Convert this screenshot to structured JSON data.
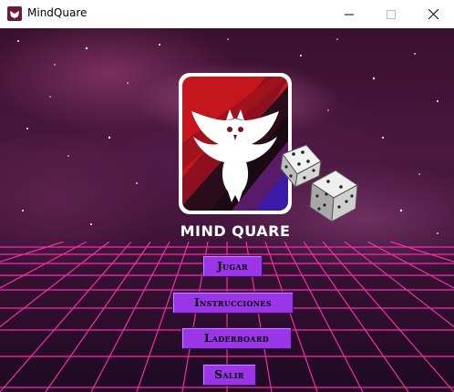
{
  "window": {
    "title": "MindQuare",
    "controls": [
      "minimize-icon",
      "maximize-icon",
      "close-icon"
    ]
  },
  "main": {
    "game_title": "MIND QUARE",
    "logo_icon": "owl-icon",
    "dice_icon": "dice-icon",
    "buttons": {
      "play": "Jugar",
      "instructions": "Instrucciones",
      "leaderboard": "Laderboard",
      "exit": "Salir"
    }
  },
  "colors": {
    "button_bg": "#9a35e8",
    "grid_line": "#ff2fb0",
    "logo_red": "#c4161c",
    "logo_blue": "#3b1aa8"
  }
}
